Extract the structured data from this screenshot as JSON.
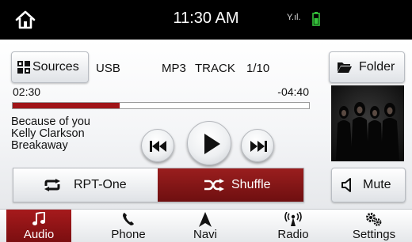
{
  "status": {
    "time": "11:30 AM",
    "signal_text": "Y.ıl."
  },
  "media": {
    "sources_label": "Sources",
    "source_name": "USB",
    "track_format": "MP3",
    "track_word": "TRACK",
    "track_position": "1/10",
    "folder_label": "Folder",
    "elapsed": "02:30",
    "remaining": "-04:40",
    "progress_fraction": 0.36,
    "song": {
      "title": "Because of you",
      "artist": "Kelly Clarkson",
      "album": "Breakaway"
    },
    "repeat_label": "RPT-One",
    "shuffle_label": "Shuffle",
    "mute_label": "Mute"
  },
  "nav": {
    "items": [
      {
        "label": "Audio",
        "icon": "music-note-icon"
      },
      {
        "label": "Phone",
        "icon": "phone-icon"
      },
      {
        "label": "Navi",
        "icon": "navigation-arrow-icon"
      },
      {
        "label": "Radio",
        "icon": "radio-antenna-icon"
      },
      {
        "label": "Settings",
        "icon": "gears-icon"
      }
    ],
    "active_index": 0
  },
  "colors": {
    "accent_red": "#a01418",
    "status_bar": "#000000",
    "battery_green": "#35c43b"
  }
}
